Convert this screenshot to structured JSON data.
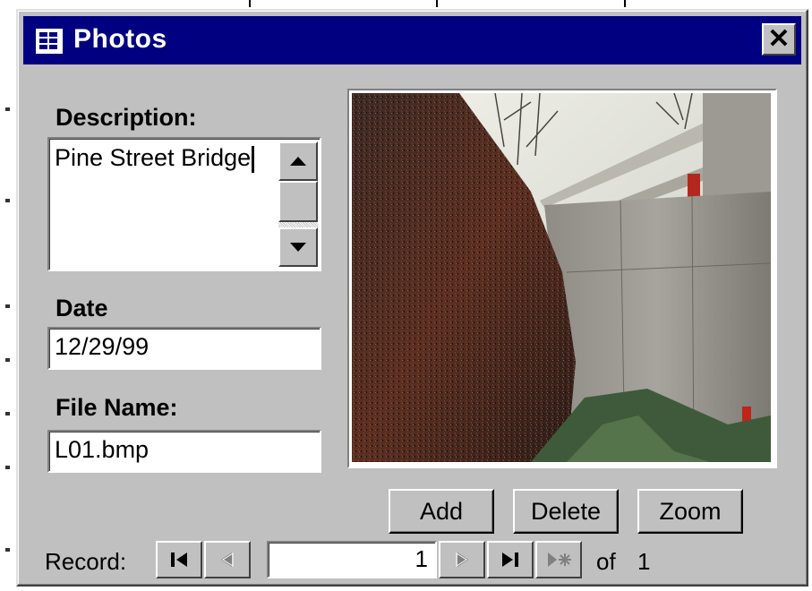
{
  "window": {
    "title": "Photos",
    "title_icon": "form-icon",
    "close_label": "✕",
    "colors": {
      "titlebar": "#000080",
      "face": "#c0c0c0"
    }
  },
  "fields": {
    "description": {
      "label": "Description:",
      "value": "Pine Street Bridge"
    },
    "date": {
      "label": "Date",
      "value": "12/29/99"
    },
    "file_name": {
      "label": "File Name:",
      "value": "L01.bmp"
    }
  },
  "photo": {
    "alt": "Pine Street Bridge"
  },
  "buttons": {
    "add": "Add",
    "delete": "Delete",
    "zoom": "Zoom"
  },
  "navigator": {
    "label": "Record:",
    "current": "1",
    "of_label": "of",
    "total": "1",
    "icons": [
      "first-record-icon",
      "previous-record-icon",
      "next-record-icon",
      "last-record-icon",
      "new-record-icon"
    ]
  }
}
